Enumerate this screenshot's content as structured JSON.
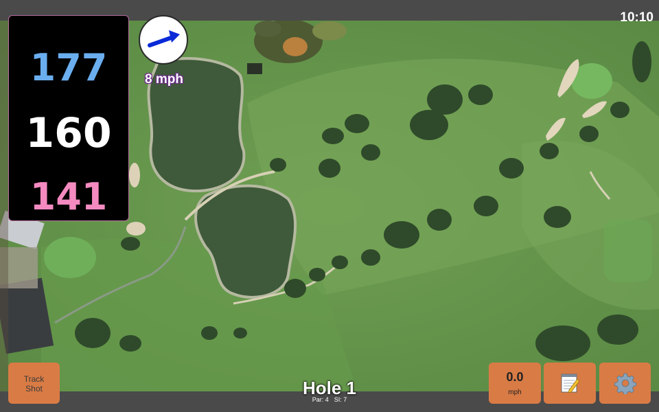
{
  "status": {
    "time": "10:10"
  },
  "yardage": {
    "back": "177",
    "middle": "160",
    "front": "141"
  },
  "wind": {
    "speed_text": "8 mph",
    "icon": "wind-direction-arrow"
  },
  "hole": {
    "title": "Hole 1",
    "par_text": "Par: 4",
    "si_text": "SI: 7"
  },
  "buttons": {
    "track_line1": "Track",
    "track_line2": "Shot",
    "speed_value": "0.0",
    "speed_unit": "mph",
    "notes_icon": "notepad-icon",
    "settings_icon": "gear-icon"
  },
  "colors": {
    "back": "#6aaef0",
    "middle": "#ffffff",
    "front": "#f48ac0",
    "button": "#d97b45",
    "wind_text_outline": "#6a2a8a"
  }
}
